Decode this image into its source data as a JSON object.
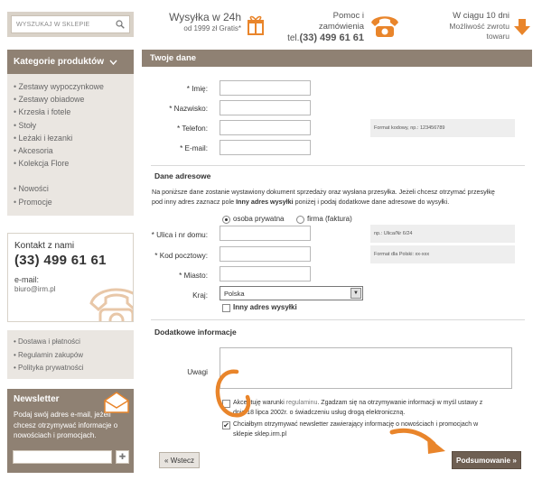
{
  "header": {
    "search_placeholder": "WYSZUKAJ W SKLEPIE",
    "shipping_title": "Wysyłka w 24h",
    "shipping_sub": "od 1999 zł Gratis*",
    "help_title": "Pomoc i zamówienia",
    "help_tel_prefix": "tel.",
    "help_tel": "(33) 499 61 61",
    "return_title": "W ciągu 10 dni",
    "return_sub": "Możliwość zwrotu towaru"
  },
  "sidebar": {
    "categories_title": "Kategorie produktów",
    "categories": [
      "Zestawy wypoczynkowe",
      "Zestawy obiadowe",
      "Krzesła i fotele",
      "Stoły",
      "Leżaki i łezanki",
      "Akcesoria",
      "Kolekcja Flore"
    ],
    "extra": [
      "Nowości",
      "Promocje"
    ],
    "contact_title": "Kontakt z nami",
    "contact_phone": "(33) 499 61 61",
    "contact_email_label": "e-mail:",
    "contact_email": "biuro@irm.pl",
    "links": [
      "Dostawa i płatności",
      "Regulamin zakupów",
      "Polityka prywatności"
    ],
    "newsletter_title": "Newsletter",
    "newsletter_desc": "Podaj swój adres e-mail, jeżeli chcesz otrzymywać informacje o nowościach i promocjach."
  },
  "form": {
    "title": "Twoje dane",
    "fields": {
      "first_name": "* Imię:",
      "last_name": "* Nazwisko:",
      "phone": "* Telefon:",
      "email": "* E-mail:"
    },
    "phone_hint": "Format kodowy, np.: 123456789",
    "address_title": "Dane adresowe",
    "address_note_1": "Na poniższe dane zostanie wystawiony dokument sprzedaży oraz wysłana przesyłka. Jeżeli chcesz otrzymać przesyłkę",
    "address_note_2a": "pod inny adres zaznacz pole ",
    "address_note_bold": "Inny adres wysyłki",
    "address_note_2b": " poniżej i podaj dodatkowe dane adresowe do wysyłki.",
    "radio_private": "osoba prywatna",
    "radio_company": "firma (faktura)",
    "street": "* Ulica i nr domu:",
    "street_hint": "np.: Ulica/Nr 6/24",
    "postal": "* Kod pocztowy:",
    "postal_hint": "Format dla Polski: xx-xxx",
    "city": "* Miasto:",
    "country_label": "Kraj:",
    "country_value": "Polska",
    "other_address": "Inny adres wysyłki",
    "extra_title": "Dodatkowe informacje",
    "notes_label": "Uwagi",
    "consent_1a": "Akceptuję warunki ",
    "consent_1_link": "regulaminu",
    "consent_1b": ". Zgadzam się na otrzymywanie informacji w myśl ustawy z",
    "consent_1c": "dnia 18 lipca 2002r. o świadczeniu usług drogą elektroniczną.",
    "consent_2a": "Chciałbym otrzymywać newsletter zawierający informację o nowościach i promocjach w",
    "consent_2b": "sklepie sklep.irm.pl",
    "consent_1_checked": false,
    "consent_2_checked": true,
    "back_label": "« Wstecz",
    "submit_label": "Podsumowanie »"
  },
  "colors": {
    "sidebar_head": "#8f8173",
    "accent_orange": "#e9852b",
    "submit_bg": "#6e5f52"
  }
}
